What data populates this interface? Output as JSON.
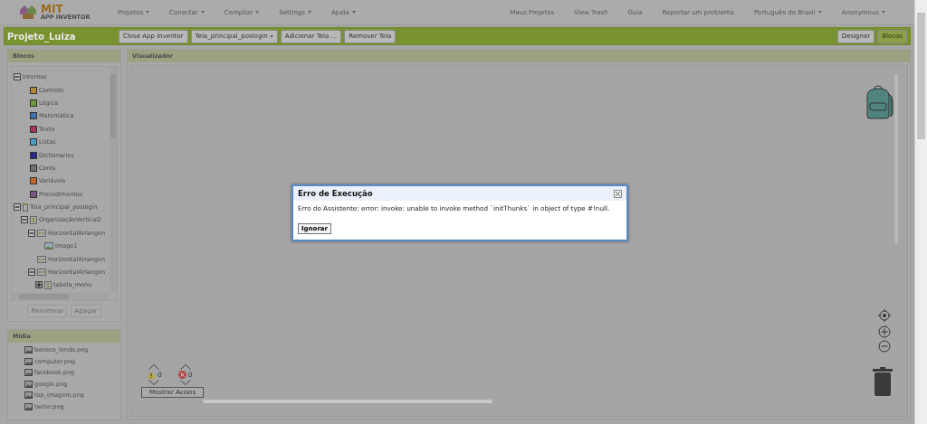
{
  "app": {
    "logo_title": "MIT",
    "logo_subtitle": "APP INVENTOR"
  },
  "nav_menus": [
    {
      "label": "Projetos",
      "dropdown": true
    },
    {
      "label": "Conectar",
      "dropdown": true
    },
    {
      "label": "Compilar",
      "dropdown": true
    },
    {
      "label": "Settings",
      "dropdown": true
    },
    {
      "label": "Ajuda",
      "dropdown": true
    }
  ],
  "nav_links": [
    {
      "label": "Meus Projetos",
      "dropdown": false
    },
    {
      "label": "View Trash",
      "dropdown": false
    },
    {
      "label": "Guia",
      "dropdown": false
    },
    {
      "label": "Reportar um problema",
      "dropdown": false
    },
    {
      "label": "Português do Brasil",
      "dropdown": true
    },
    {
      "label": "Anonymous",
      "dropdown": true
    }
  ],
  "project_bar": {
    "title": "Projeto_Luiza",
    "buttons": [
      {
        "label": "Close App Inventor",
        "dropdown": false
      },
      {
        "label": "Tela_principal_poslogin",
        "dropdown": true
      },
      {
        "label": "Adicionar Tela ...",
        "dropdown": false
      },
      {
        "label": "Remover Tela",
        "dropdown": false
      }
    ],
    "modes": [
      {
        "label": "Designer",
        "selected": false
      },
      {
        "label": "Blocos",
        "selected": true
      }
    ]
  },
  "blocks_panel": {
    "title": "Blocos",
    "tree": [
      {
        "label": "Internos",
        "kind": "group",
        "expanded": true,
        "children": [
          {
            "label": "Controle",
            "kind": "category",
            "color": "#b08a3a"
          },
          {
            "label": "Lógica",
            "kind": "category",
            "color": "#6f9a3c"
          },
          {
            "label": "Matemática",
            "kind": "category",
            "color": "#3f6ea8"
          },
          {
            "label": "Texto",
            "kind": "category",
            "color": "#a8345c"
          },
          {
            "label": "Listas",
            "kind": "category",
            "color": "#4a9cc0"
          },
          {
            "label": "Dictionaries",
            "kind": "category",
            "color": "#2c2a8a"
          },
          {
            "label": "Cores",
            "kind": "category",
            "color": "#6f6f6f"
          },
          {
            "label": "Variáveis",
            "kind": "category",
            "color": "#c0682c"
          },
          {
            "label": "Procedimentos",
            "kind": "category",
            "color": "#7a5482"
          }
        ]
      },
      {
        "label": "Tela_principal_poslogin",
        "kind": "screen",
        "expanded": true,
        "children": [
          {
            "label": "OrganizaçãoVertical2",
            "kind": "vertical",
            "expanded": true,
            "children": [
              {
                "label": "HorizontalArrangen",
                "kind": "horizontal",
                "expanded": true,
                "children": [
                  {
                    "label": "Image1",
                    "kind": "image"
                  }
                ]
              },
              {
                "label": "HorizontalArrangen",
                "kind": "horizontal"
              },
              {
                "label": "HorizontalArrangen",
                "kind": "horizontal",
                "expanded": true,
                "children": [
                  {
                    "label": "tabela_menu",
                    "kind": "table",
                    "expanded": false
                  }
                ]
              }
            ]
          }
        ]
      }
    ],
    "buttons": [
      "Renomear",
      "Apagar"
    ]
  },
  "media_panel": {
    "title": "Mídia",
    "files": [
      "boneco_lendo.png",
      "computer.png",
      "facebook.png",
      "google.png",
      "top_imagem.png",
      "twiter.png"
    ]
  },
  "workspace": {
    "title": "Visualizador",
    "warning_count": "0",
    "error_count": "0",
    "warnings_button": "Mostrar Avisos"
  },
  "dialog": {
    "title": "Erro de Execução",
    "message": "Erro do Assistente: error: invoke: unable to invoke method `initThunks` in object of type #!null.",
    "button": "Ignorar"
  }
}
